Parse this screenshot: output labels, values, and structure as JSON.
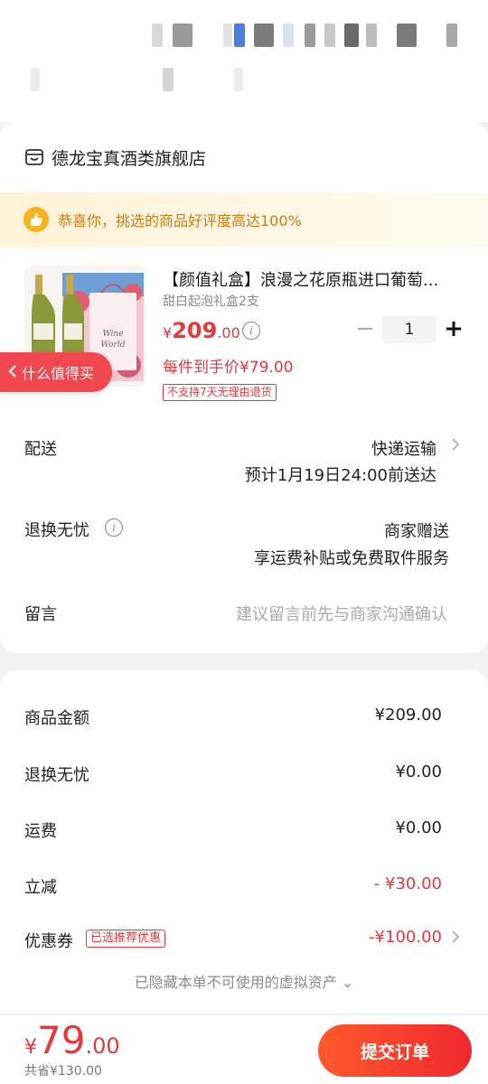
{
  "store": {
    "name": "德龙宝真酒类旗舰店",
    "icon": "store-icon"
  },
  "praise": {
    "text": "恭喜你，挑选的商品好评度高达100%",
    "icon": "thumbs-up-icon"
  },
  "product": {
    "title": "【颜值礼盒】浪漫之花原瓶进口葡萄...",
    "spec": "甜白起泡礼盒2支",
    "price_symbol": "¥",
    "price_int": "209",
    "price_dec": ".00",
    "unit_price": "每件到手价¥79.00",
    "return_badge": "不支持7天无理由退货",
    "quantity": "1",
    "worth_tag": "什么值得买",
    "box_text": "Wine World"
  },
  "delivery": {
    "label": "配送",
    "method": "快递运输",
    "eta": "预计1月19日24:00前送达"
  },
  "return_service": {
    "label": "退换无忧",
    "value": "商家赠送",
    "desc": "享运费补贴或免费取件服务"
  },
  "message": {
    "label": "留言",
    "placeholder": "建议留言前先与商家沟通确认"
  },
  "summary": {
    "goods_label": "商品金额",
    "goods_value": "¥209.00",
    "return_label": "退换无忧",
    "return_value": "¥0.00",
    "shipping_label": "运费",
    "shipping_value": "¥0.00",
    "discount_label": "立减",
    "discount_value": "- ¥30.00",
    "coupon_label": "优惠券",
    "coupon_tag": "已选推荐优惠",
    "coupon_value": "-¥100.00",
    "hidden_note": "已隐藏本单不可使用的虚拟资产 ⌄"
  },
  "footer": {
    "total_symbol": "¥",
    "total_int": "79",
    "total_dec": ".00",
    "saved": "共省¥130.00",
    "submit": "提交订单"
  },
  "colors": {
    "accent": "#e4393c",
    "button": "#f0282f",
    "praise": "#c97a12"
  }
}
